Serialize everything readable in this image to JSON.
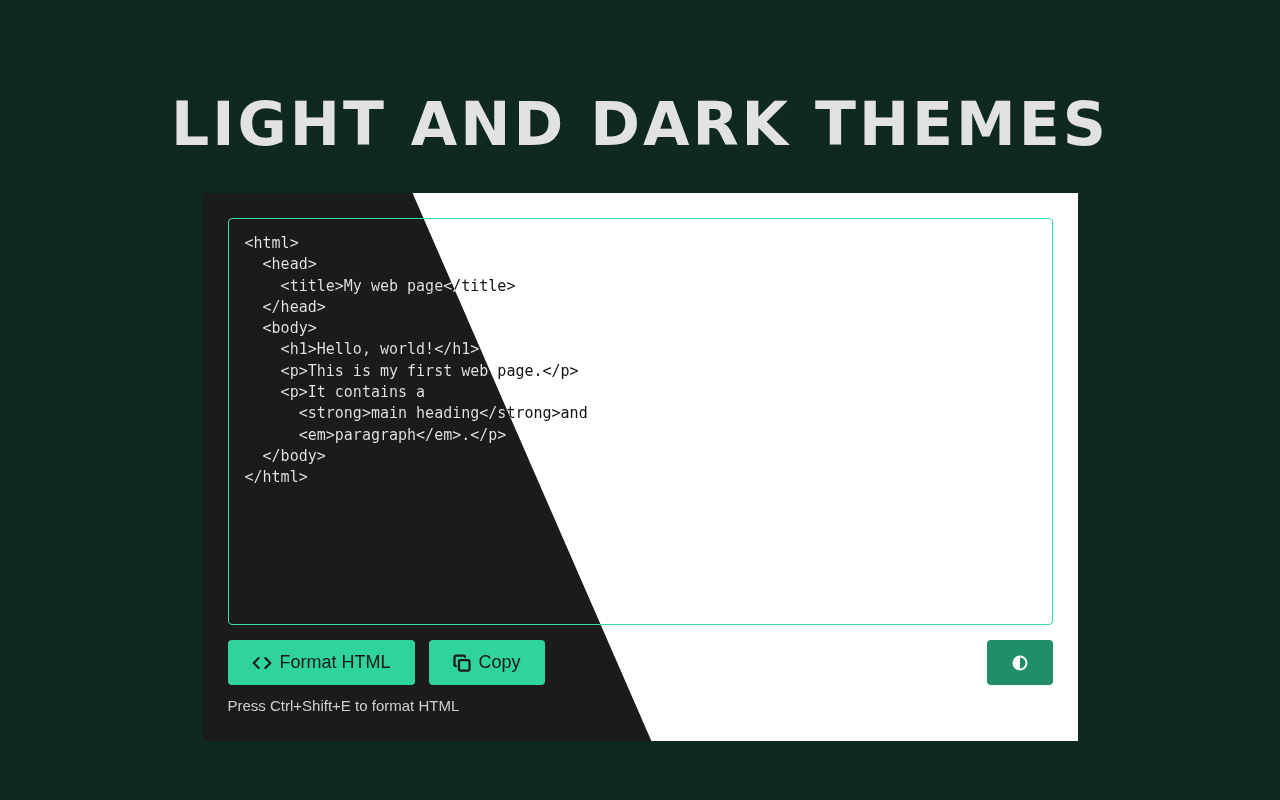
{
  "title": "LIGHT AND DARK THEMES",
  "editor": {
    "lines": [
      "<html>",
      "  <head>",
      "    <title>My web page</title>",
      "  </head>",
      "  <body>",
      "    <h1>Hello, world!</h1>",
      "    <p>This is my first web page.</p>",
      "    <p>It contains a",
      "      <strong>main heading</strong>and",
      "      <em>paragraph</em>.</p>",
      "  </body>",
      "</html>"
    ]
  },
  "buttons": [
    {
      "kind": "format",
      "label": "Format HTML"
    },
    {
      "kind": "copy",
      "label": "Copy"
    },
    {
      "kind": "theme"
    }
  ],
  "hint": "Press Ctrl+Shift+E to format HTML"
}
